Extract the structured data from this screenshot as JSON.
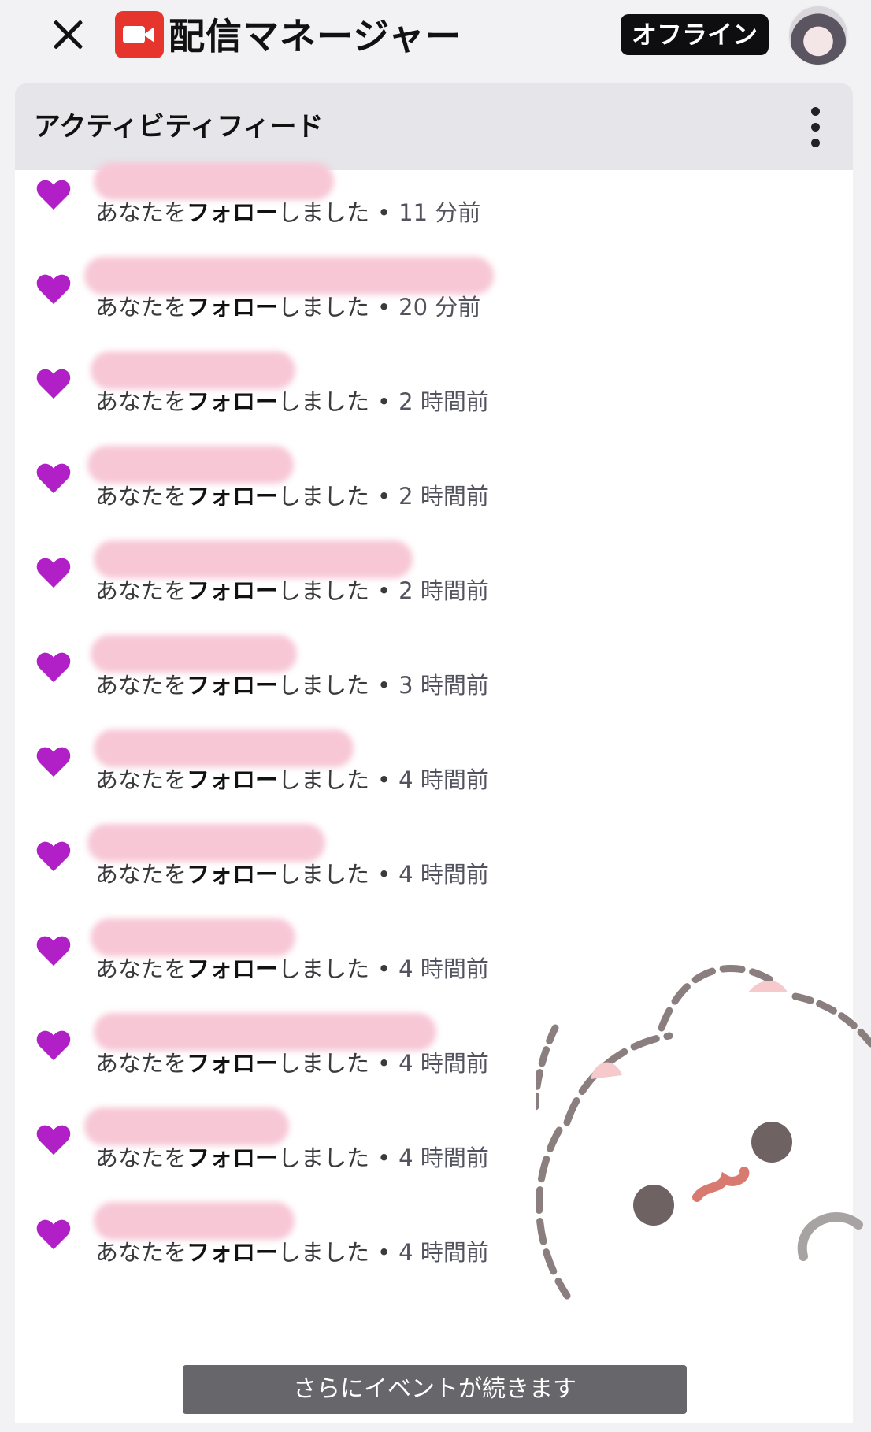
{
  "header": {
    "title": "配信マネージャー",
    "status": "オフライン"
  },
  "panel": {
    "title": "アクティビティフィード"
  },
  "feed": {
    "prefix": "あなたを",
    "action": "フォロー",
    "suffix": "しました",
    "separator": "•",
    "items": [
      {
        "time": "11 分前"
      },
      {
        "time": "20 分前"
      },
      {
        "time": "2 時間前"
      },
      {
        "time": "2 時間前"
      },
      {
        "time": "2 時間前"
      },
      {
        "time": "3 時間前"
      },
      {
        "time": "4 時間前"
      },
      {
        "time": "4 時間前"
      },
      {
        "time": "4 時間前"
      },
      {
        "time": "4 時間前"
      },
      {
        "time": "4 時間前"
      },
      {
        "time": "4 時間前"
      }
    ]
  },
  "toast": {
    "text": "さらにイベントが続きます"
  },
  "colors": {
    "heart": "#b120c7",
    "status_badge": "#0e0e10",
    "camera_icon": "#e5352d"
  },
  "icons": [
    "close-icon",
    "camera-icon",
    "more-vertical-icon",
    "heart-icon"
  ]
}
